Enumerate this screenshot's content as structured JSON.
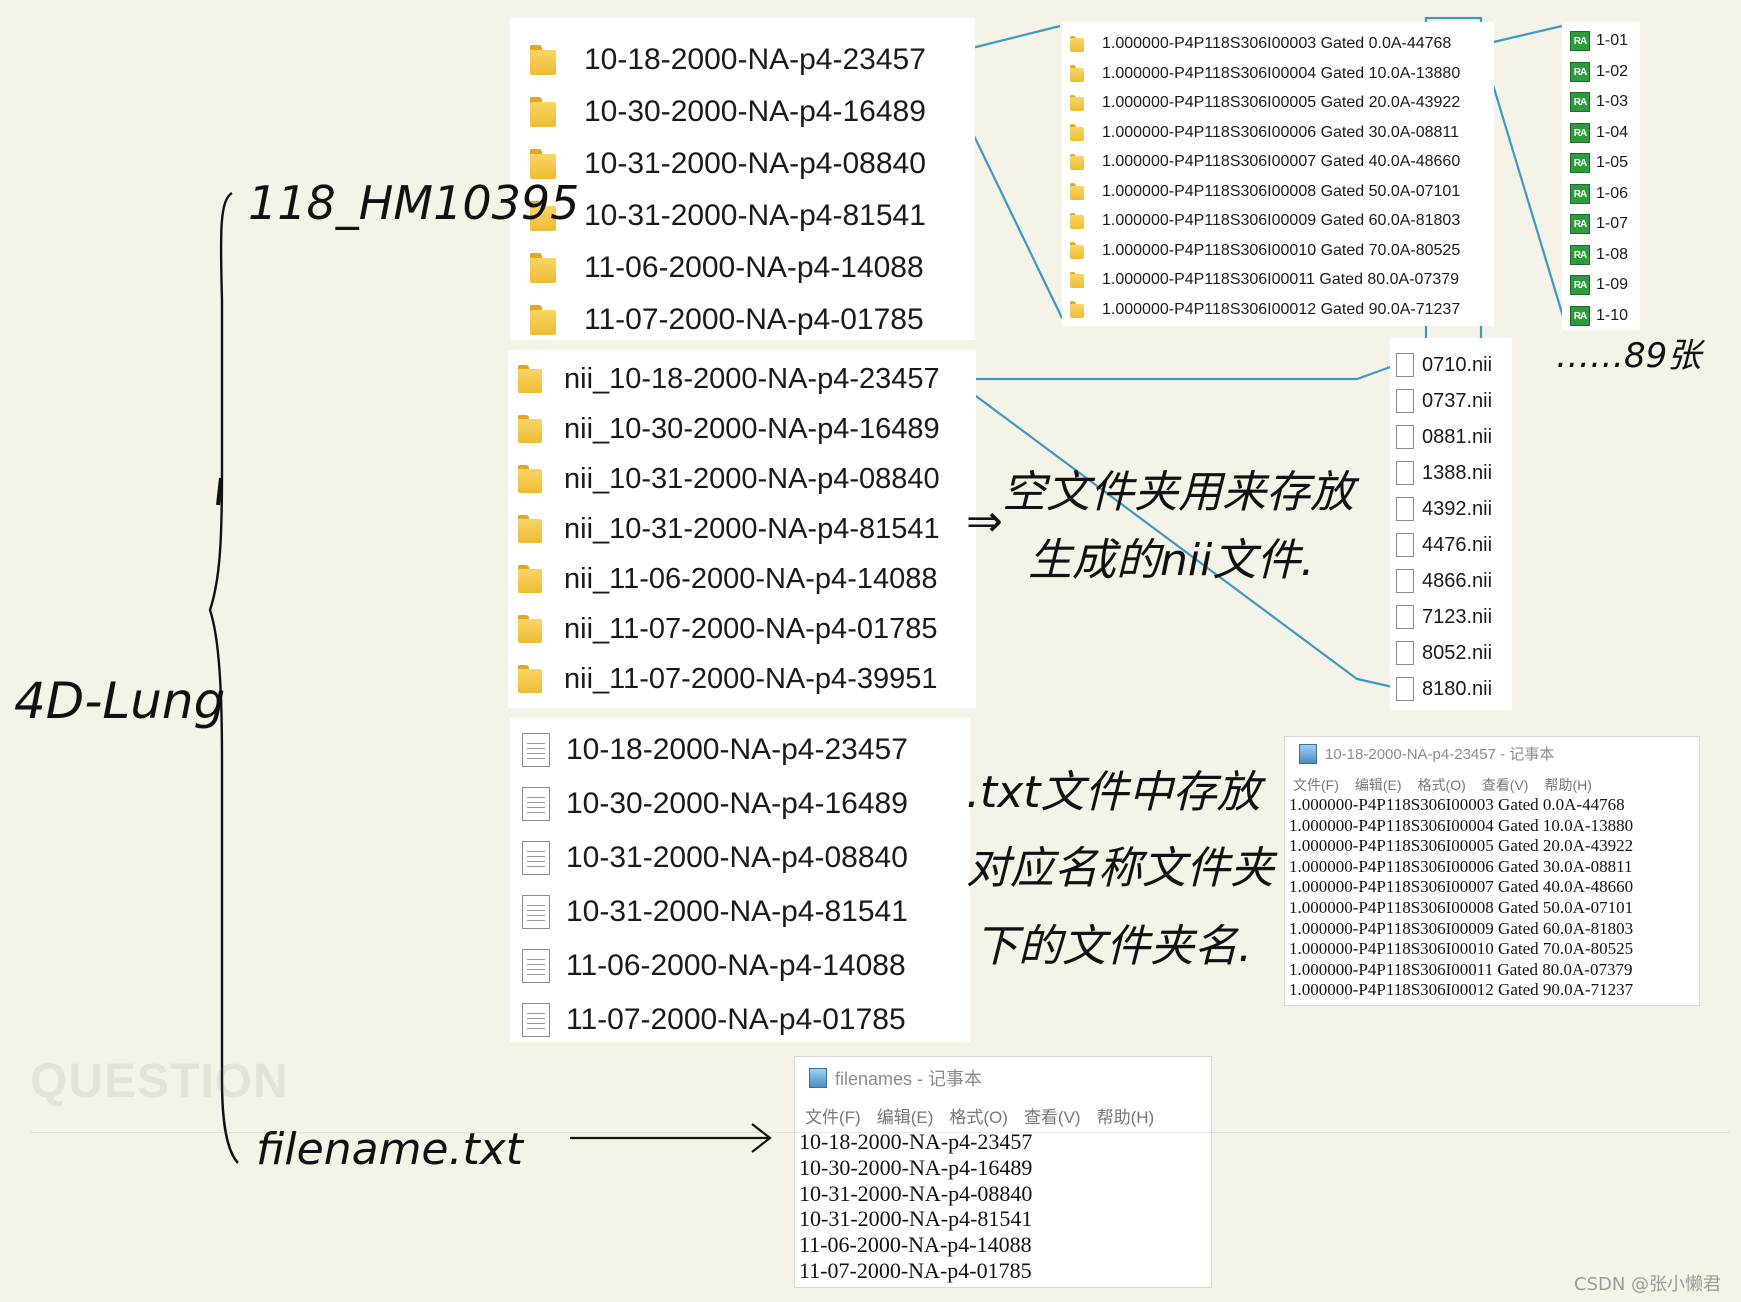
{
  "root_label": "4D-Lung",
  "subfolder_label": "118_HM10395",
  "date_folders": [
    "10-18-2000-NA-p4-23457",
    "10-30-2000-NA-p4-16489",
    "10-31-2000-NA-p4-08840",
    "10-31-2000-NA-p4-81541",
    "11-06-2000-NA-p4-14088",
    "11-07-2000-NA-p4-01785"
  ],
  "nii_folders": [
    "nii_10-18-2000-NA-p4-23457",
    "nii_10-30-2000-NA-p4-16489",
    "nii_10-31-2000-NA-p4-08840",
    "nii_10-31-2000-NA-p4-81541",
    "nii_11-06-2000-NA-p4-14088",
    "nii_11-07-2000-NA-p4-01785",
    "nii_11-07-2000-NA-p4-39951"
  ],
  "txt_files": [
    "10-18-2000-NA-p4-23457",
    "10-30-2000-NA-p4-16489",
    "10-31-2000-NA-p4-08840",
    "10-31-2000-NA-p4-81541",
    "11-06-2000-NA-p4-14088",
    "11-07-2000-NA-p4-01785"
  ],
  "gated_folders": [
    "1.000000-P4P118S306I00003 Gated 0.0A-44768",
    "1.000000-P4P118S306I00004 Gated 10.0A-13880",
    "1.000000-P4P118S306I00005 Gated 20.0A-43922",
    "1.000000-P4P118S306I00006 Gated 30.0A-08811",
    "1.000000-P4P118S306I00007 Gated 40.0A-48660",
    "1.000000-P4P118S306I00008 Gated 50.0A-07101",
    "1.000000-P4P118S306I00009 Gated 60.0A-81803",
    "1.000000-P4P118S306I00010 Gated 70.0A-80525",
    "1.000000-P4P118S306I00011 Gated 80.0A-07379",
    "1.000000-P4P118S306I00012 Gated 90.0A-71237"
  ],
  "dicom_files": [
    "1-01",
    "1-02",
    "1-03",
    "1-04",
    "1-05",
    "1-06",
    "1-07",
    "1-08",
    "1-09",
    "1-10"
  ],
  "dicom_icon_text": "RA",
  "nii_files": [
    "0710.nii",
    "0737.nii",
    "0881.nii",
    "1388.nii",
    "4392.nii",
    "4476.nii",
    "4866.nii",
    "7123.nii",
    "8052.nii",
    "8180.nii"
  ],
  "notepad1": {
    "title": "10-18-2000-NA-p4-23457 - 记事本",
    "menu": [
      "文件(F)",
      "编辑(E)",
      "格式(O)",
      "查看(V)",
      "帮助(H)"
    ],
    "lines": [
      "1.000000-P4P118S306I00003 Gated 0.0A-44768",
      "1.000000-P4P118S306I00004 Gated 10.0A-13880",
      "1.000000-P4P118S306I00005 Gated 20.0A-43922",
      "1.000000-P4P118S306I00006 Gated 30.0A-08811",
      "1.000000-P4P118S306I00007 Gated 40.0A-48660",
      "1.000000-P4P118S306I00008 Gated 50.0A-07101",
      "1.000000-P4P118S306I00009 Gated 60.0A-81803",
      "1.000000-P4P118S306I00010 Gated 70.0A-80525",
      "1.000000-P4P118S306I00011 Gated 80.0A-07379",
      "1.000000-P4P118S306I00012 Gated 90.0A-71237"
    ]
  },
  "notepad2": {
    "title": "filenames - 记事本",
    "menu": [
      "文件(F)",
      "编辑(E)",
      "格式(O)",
      "查看(V)",
      "帮助(H)"
    ],
    "lines": [
      "10-18-2000-NA-p4-23457",
      "10-30-2000-NA-p4-16489",
      "10-31-2000-NA-p4-08840",
      "10-31-2000-NA-p4-81541",
      "11-06-2000-NA-p4-14088",
      "11-07-2000-NA-p4-01785"
    ]
  },
  "file_label": "filename.txt",
  "annotations": {
    "count_note": "……89张",
    "nii_note_1": "空文件夹用来存放",
    "nii_note_2": "生成的nii文件.",
    "txt_note_1": ".txt文件中存放",
    "txt_note_2": "对应名称文件夹",
    "txt_note_3": "下的文件夹名.",
    "arrow_symbol": "⇒"
  },
  "watermark": "QUESTION",
  "credit": "CSDN @张小懒君",
  "colors": {
    "connector": "#3b9ac2",
    "background": "#f5f3e8"
  }
}
